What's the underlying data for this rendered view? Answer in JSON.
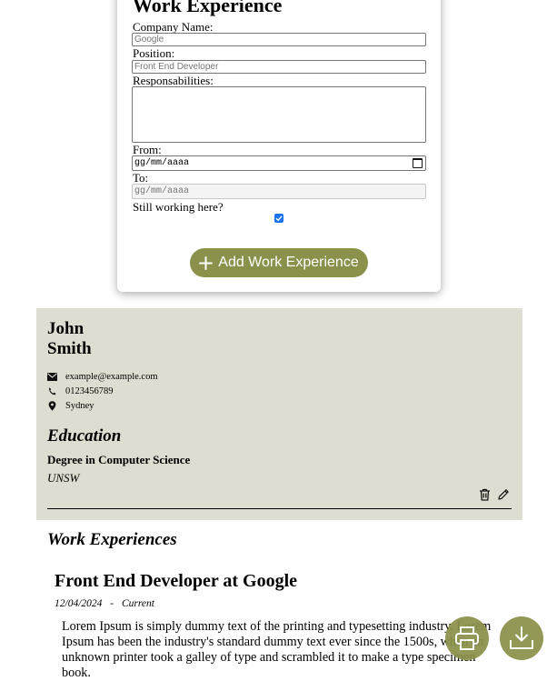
{
  "form": {
    "title": "Work Experience",
    "company_label": "Company Name:",
    "company_placeholder": "Google",
    "position_label": "Position:",
    "position_placeholder": "Front End Developer",
    "responsibilities_label": "Responsabilities:",
    "from_label": "From:",
    "from_placeholder": "gg/mm/aaaa",
    "to_label": "To:",
    "to_placeholder": "gg/mm/aaaa",
    "still_working_label": "Still working here?",
    "still_working_checked": true,
    "add_button_label": "Add Work Experience",
    "accent_color": "#8b914a"
  },
  "resume": {
    "first_name": "John",
    "last_name": "Smith",
    "email": "example@example.com",
    "phone": "0123456789",
    "location": "Sydney",
    "education_title": "Education",
    "degree": "Degree in Computer Science",
    "university": "UNSW",
    "work_title": "Work Experiences",
    "job": {
      "title": "Front End Developer at Google",
      "start": "12/04/2024",
      "separator": "-",
      "end": "Current",
      "description": "Lorem Ipsum is simply dummy text of the printing and typesetting industry. Lorem Ipsum has been the industry's standard dummy text ever since the 1500s, when an unknown printer took a galley of type and scrambled it to make a type specimen book."
    },
    "panel_color": "#deddd2"
  },
  "icons": {
    "email": "envelope-icon",
    "phone": "phone-icon",
    "location": "map-pin-icon",
    "delete": "trash-icon",
    "edit": "pencil-icon",
    "print": "printer-icon",
    "download": "download-icon"
  }
}
